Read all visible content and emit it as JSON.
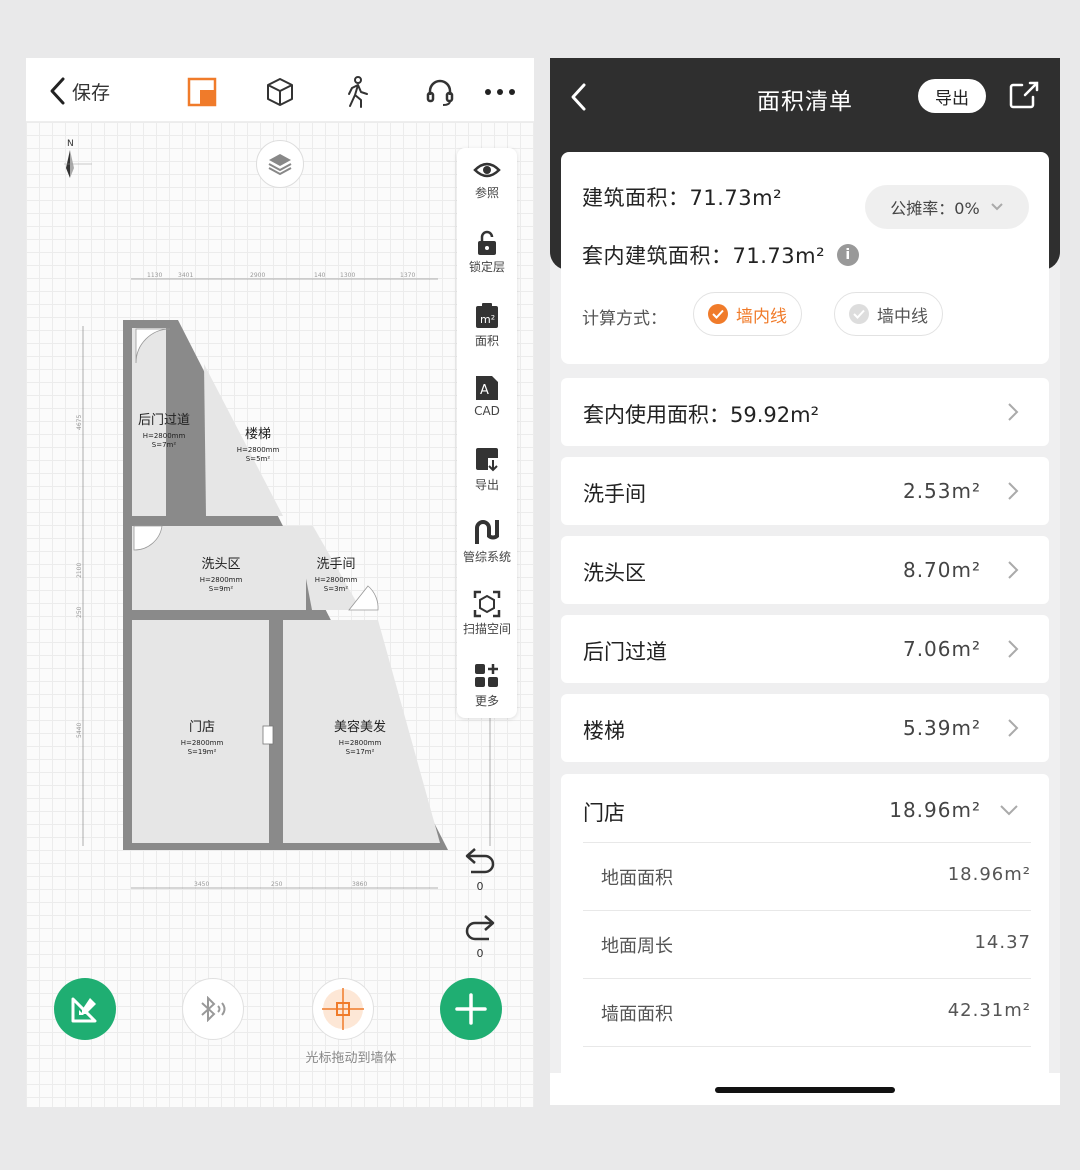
{
  "left": {
    "topbar": {
      "save_label": "保存"
    },
    "toolbox": [
      {
        "icon": "eye-icon",
        "label": "参照"
      },
      {
        "icon": "lock-icon",
        "label": "锁定层"
      },
      {
        "icon": "area-icon",
        "label": "面积"
      },
      {
        "icon": "cad-icon",
        "label": "CAD"
      },
      {
        "icon": "export-icon",
        "label": "导出"
      },
      {
        "icon": "pipe-icon",
        "label": "管综系统"
      },
      {
        "icon": "scan-icon",
        "label": "扫描空间"
      },
      {
        "icon": "more-icon",
        "label": "更多"
      }
    ],
    "undo_count": "0",
    "redo_count": "0",
    "cursor_hint": "光标拖动到墙体",
    "rooms": [
      {
        "name": "后门过道",
        "h": "H=2800mm",
        "s": "S=7m²"
      },
      {
        "name": "楼梯",
        "h": "H=2800mm",
        "s": "S=5m²"
      },
      {
        "name": "洗头区",
        "h": "H=2800mm",
        "s": "S=9m²"
      },
      {
        "name": "洗手间",
        "h": "H=2800mm",
        "s": "S=3m²"
      },
      {
        "name": "门店",
        "h": "H=2800mm",
        "s": "S=19m²"
      },
      {
        "name": "美容美发",
        "h": "H=2800mm",
        "s": "S=17m²"
      }
    ],
    "dims_top": [
      "1130",
      "3401",
      "2900",
      "140",
      "1300",
      "1370"
    ],
    "dims_bottom": [
      "3450",
      "250",
      "3860"
    ],
    "dims_left": [
      "4675",
      "2100",
      "250",
      "5440"
    ]
  },
  "right": {
    "title": "面积清单",
    "export_label": "导出",
    "building_area": "建筑面积：71.73m²",
    "share_rate": "公摊率：0%",
    "inner_building_area": "套内建筑面积：71.73m²",
    "calc_label": "计算方式：",
    "calc_options": [
      {
        "label": "墙内线",
        "selected": true
      },
      {
        "label": "墙中线",
        "selected": false
      }
    ],
    "usable_area": "套内使用面积：59.92m²",
    "rooms": [
      {
        "label": "洗手间",
        "value": "2.53m²"
      },
      {
        "label": "洗头区",
        "value": "8.70m²"
      },
      {
        "label": "后门过道",
        "value": "7.06m²"
      },
      {
        "label": "楼梯",
        "value": "5.39m²"
      }
    ],
    "expanded": {
      "label": "门店",
      "value": "18.96m²",
      "details": [
        {
          "label": "地面面积",
          "value": "18.96m²"
        },
        {
          "label": "地面周长",
          "value": "14.37"
        },
        {
          "label": "墙面面积",
          "value": "42.31m²"
        }
      ]
    },
    "colors": {
      "accent": "#f07b2a",
      "green": "#1fae72",
      "header": "#2f2f2f"
    }
  }
}
